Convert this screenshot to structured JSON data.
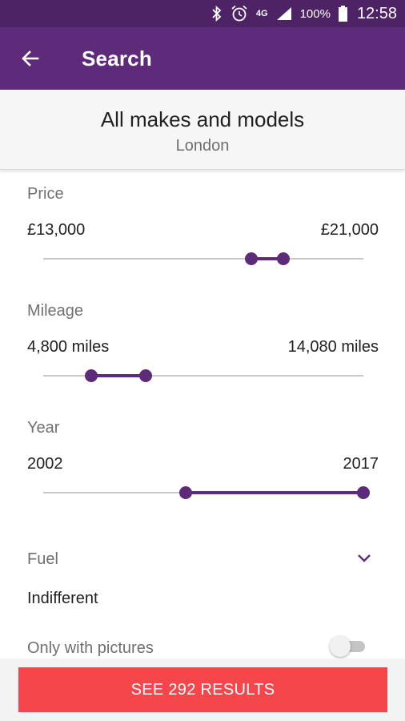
{
  "status_bar": {
    "network": "4G",
    "battery": "100%",
    "time": "12:58",
    "icons": [
      "bluetooth-icon",
      "alarm-icon",
      "network-4g-icon",
      "signal-icon",
      "battery-icon"
    ]
  },
  "app_bar": {
    "title": "Search",
    "back_icon": "back-arrow-icon"
  },
  "header": {
    "make_model": "All makes and models",
    "location": "London"
  },
  "filters": {
    "price": {
      "label": "Price",
      "min_value": "£13,000",
      "max_value": "£21,000",
      "range_start": 0.65,
      "range_end": 0.75
    },
    "mileage": {
      "label": "Mileage",
      "min_value": "4,800 miles",
      "max_value": "14,080 miles",
      "range_start": 0.15,
      "range_end": 0.32
    },
    "year": {
      "label": "Year",
      "min_value": "2002",
      "max_value": "2017",
      "range_start": 0.445,
      "range_end": 1.0
    },
    "fuel": {
      "label": "Fuel",
      "value": "Indifferent",
      "icon": "chevron-down-icon"
    },
    "pictures": {
      "label": "Only with pictures",
      "enabled": false
    }
  },
  "action": {
    "results_label": "SEE 292 RESULTS"
  },
  "colors": {
    "primary": "#5d2b7a",
    "status_bar": "#4e2366",
    "accent": "#f5474b"
  }
}
